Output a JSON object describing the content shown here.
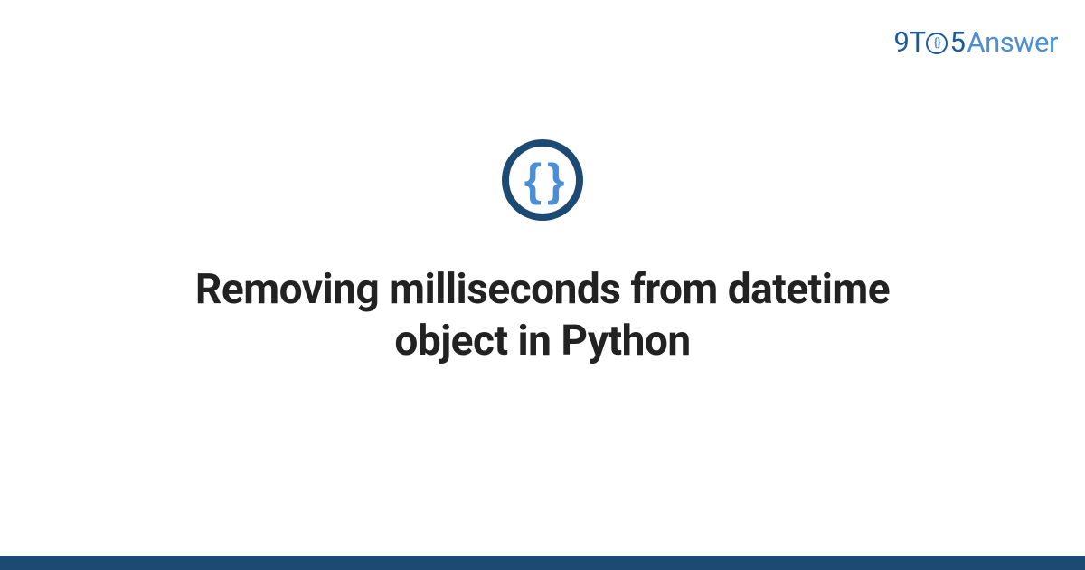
{
  "logo": {
    "part1": "9T",
    "clock_braces": "{}",
    "part2": "5",
    "part3": "Answer"
  },
  "category_icon": {
    "name": "code-braces-icon",
    "content": "{ }"
  },
  "title": "Removing milliseconds from datetime object in Python",
  "colors": {
    "primary_dark": "#1c4a72",
    "primary_blue": "#1c5a9e",
    "accent_blue": "#4a8fd4"
  }
}
